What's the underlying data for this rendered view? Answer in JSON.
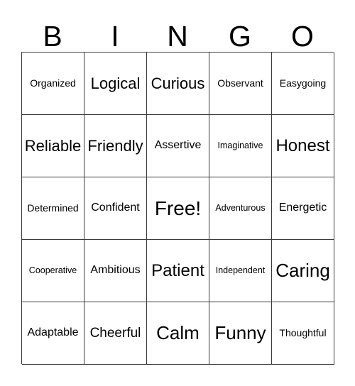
{
  "card": {
    "title_letters": [
      "B",
      "I",
      "N",
      "G",
      "O"
    ],
    "rows": [
      [
        {
          "label": "Organized",
          "size": "fs-s"
        },
        {
          "label": "Logical",
          "size": "fs-xl"
        },
        {
          "label": "Curious",
          "size": "fs-xl"
        },
        {
          "label": "Observant",
          "size": "fs-s"
        },
        {
          "label": "Easygoing",
          "size": "fs-s"
        }
      ],
      [
        {
          "label": "Reliable",
          "size": "fs-xl"
        },
        {
          "label": "Friendly",
          "size": "fs-xl"
        },
        {
          "label": "Assertive",
          "size": "fs-m"
        },
        {
          "label": "Imaginative",
          "size": "fs-xs"
        },
        {
          "label": "Honest",
          "size": "fs-xxl"
        }
      ],
      [
        {
          "label": "Determined",
          "size": "fs-s"
        },
        {
          "label": "Confident",
          "size": "fs-m"
        },
        {
          "label": "Free!",
          "size": "fs-4xl"
        },
        {
          "label": "Adventurous",
          "size": "fs-xs"
        },
        {
          "label": "Energetic",
          "size": "fs-m"
        }
      ],
      [
        {
          "label": "Cooperative",
          "size": "fs-xs"
        },
        {
          "label": "Ambitious",
          "size": "fs-m"
        },
        {
          "label": "Patient",
          "size": "fs-xxl"
        },
        {
          "label": "Independent",
          "size": "fs-xs"
        },
        {
          "label": "Caring",
          "size": "fs-3xl"
        }
      ],
      [
        {
          "label": "Adaptable",
          "size": "fs-m"
        },
        {
          "label": "Cheerful",
          "size": "fs-l"
        },
        {
          "label": "Calm",
          "size": "fs-3xl"
        },
        {
          "label": "Funny",
          "size": "fs-3xl"
        },
        {
          "label": "Thoughtful",
          "size": "fs-s"
        }
      ]
    ],
    "free_space_label": "Free!",
    "colors": {
      "background": "#ffffff",
      "text": "#000000",
      "grid_line": "#3a3a3a"
    }
  }
}
